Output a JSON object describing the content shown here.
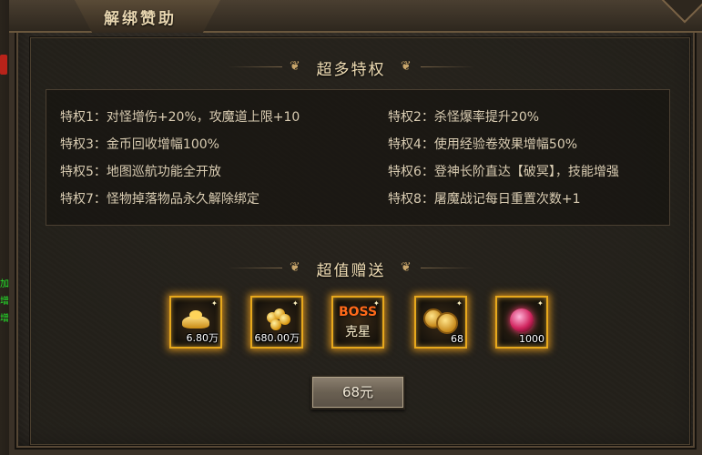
{
  "window": {
    "title": "解绑赞助"
  },
  "side_texts": [
    "加",
    "增加.",
    "增加."
  ],
  "privileges_section": {
    "title": "超多特权",
    "items": [
      "特权1：对怪增伤+20%，攻魔道上限+10",
      "特权2：杀怪爆率提升20%",
      "特权3：金币回收增幅100%",
      "特权4：使用经验卷效果增幅50%",
      "特权5：地图巡航功能全开放",
      "特权6：登神长阶直达【破冥】，技能增强",
      "特权7：怪物掉落物品永久解除绑定",
      "特权8：屠魔战记每日重置次数+1"
    ]
  },
  "gifts_section": {
    "title": "超值赠送",
    "items": [
      {
        "icon": "gold-ingot-icon",
        "quantity": "6.80万"
      },
      {
        "icon": "gold-coins-icon",
        "quantity": "680.00万"
      },
      {
        "icon": "boss-nemesis-icon",
        "label_top": "BOSS",
        "label_bottom": "克星",
        "quantity": ""
      },
      {
        "icon": "bronze-coins-icon",
        "quantity": "68"
      },
      {
        "icon": "red-gem-icon",
        "quantity": "1000"
      }
    ]
  },
  "purchase": {
    "price_label": "68元"
  },
  "colors": {
    "accent_gold": "#e7a81c",
    "text": "#d9ccb2",
    "title": "#f0ddb4",
    "boss_orange": "#ff6a1a"
  }
}
